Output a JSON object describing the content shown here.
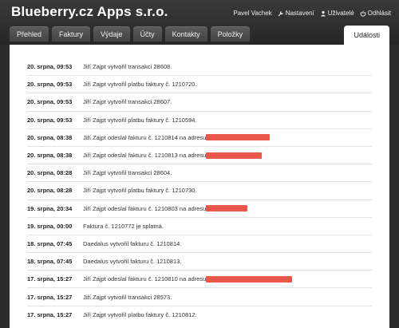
{
  "app": {
    "title": "Blueberry.cz Apps s.r.o."
  },
  "user_menu": {
    "user_name": "Pavel Vachek",
    "settings_label": "Nastavení",
    "users_label": "Uživatelé",
    "logout_label": "Odhlásit"
  },
  "tabs": [
    {
      "label": "Přehled"
    },
    {
      "label": "Faktury"
    },
    {
      "label": "Výdaje"
    },
    {
      "label": "Účty"
    },
    {
      "label": "Kontakty"
    },
    {
      "label": "Položky"
    }
  ],
  "active_tab": {
    "label": "Události"
  },
  "events": [
    {
      "date": "20. srpna, 09:53",
      "text": "Jiří Zajpt vytvořil transakci 28608."
    },
    {
      "date": "20. srpna, 09:53",
      "text": "Jiří Zajpt vytvořil platbu faktury č. 1210720."
    },
    {
      "date": "20. srpna, 09:53",
      "text": "Jiří Zajpt vytvořil transakci 28607."
    },
    {
      "date": "20. srpna, 09:53",
      "text": "Jiří Zajpt vytvořil platbu faktury č. 1210594."
    },
    {
      "date": "20. srpna, 08:38",
      "text": "Jiří Zajpt odeslal fakturu č. 1210814 na adresu"
    },
    {
      "date": "20. srpna, 08:38",
      "text": "Jiří Zajpt odeslal fakturu č. 1210813 na adresu"
    },
    {
      "date": "20. srpna, 08:28",
      "text": "Jiří Zajpt vytvořil transakci 28604."
    },
    {
      "date": "20. srpna, 08:28",
      "text": "Jiří Zajpt vytvořil platbu faktury č. 1210730."
    },
    {
      "date": "19. srpna, 20:34",
      "text": "Jiří Zajpt odeslal fakturu č. 1210803 na adresu"
    },
    {
      "date": "19. srpna, 00:00",
      "text": "Faktura č. 1210772 je splatná."
    },
    {
      "date": "18. srpna, 07:45",
      "text": "Daedalus vytvořil fakturu č. 1210814."
    },
    {
      "date": "18. srpna, 07:45",
      "text": "Daedalus vytvořil fakturu č. 1210813."
    },
    {
      "date": "17. srpna, 15:27",
      "text": "Jiří Zajpt odeslal fakturu č. 1210810 na adresu"
    },
    {
      "date": "17. srpna, 15:27",
      "text": "Jiří Zajpt vytvořil transakci 28573."
    },
    {
      "date": "17. srpna, 15:27",
      "text": "Jiří Zajpt vytvořil platbu faktury č. 1210812."
    }
  ],
  "colors": {
    "redaction": "#e8574a",
    "header_bg": "#2b2b2b"
  }
}
